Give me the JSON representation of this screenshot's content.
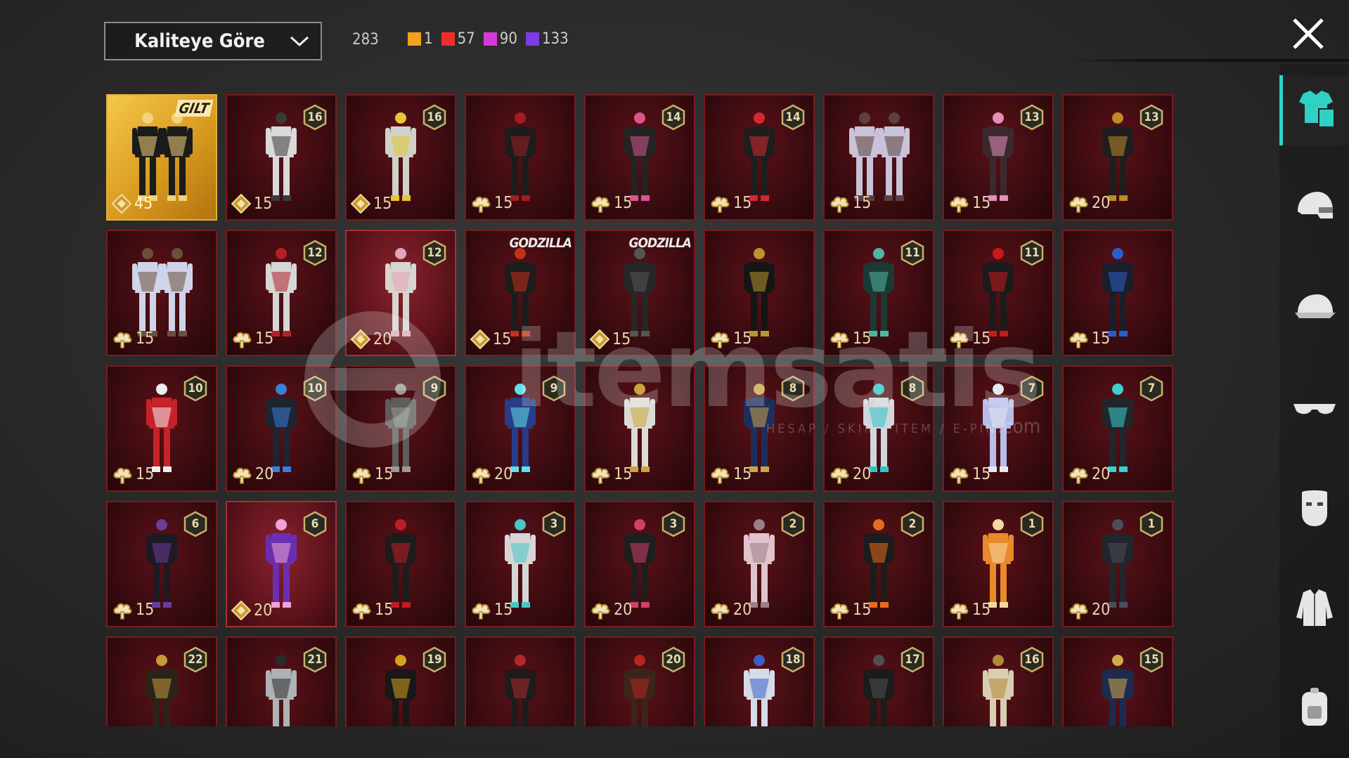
{
  "toolbar": {
    "sort_label": "Kaliteye Göre",
    "total_count": "283",
    "quality_counts": [
      {
        "color": "#f0a31b",
        "count": "1"
      },
      {
        "color": "#f02d2d",
        "count": "57"
      },
      {
        "color": "#d63ad6",
        "count": "90"
      },
      {
        "color": "#7d3ae6",
        "count": "133"
      }
    ]
  },
  "colors": {
    "rarity_red": "#5a1117",
    "rarity_gold": "#e2b23a",
    "active_tab": "#2dd3c7"
  },
  "items": [
    {
      "tag": "GILT",
      "price": "45",
      "currency": "ag",
      "rarity": "gold",
      "figure": "duo-gold"
    },
    {
      "level": "16",
      "price": "15",
      "currency": "ag",
      "figure": "white"
    },
    {
      "level": "16",
      "price": "15",
      "currency": "ag",
      "figure": "white-yellow"
    },
    {
      "price": "15",
      "currency": "uc",
      "figure": "dark-red"
    },
    {
      "level": "14",
      "price": "15",
      "currency": "uc",
      "figure": "dark-pink"
    },
    {
      "level": "14",
      "price": "15",
      "currency": "uc",
      "figure": "red-hood"
    },
    {
      "price": "15",
      "currency": "uc",
      "figure": "duo-white"
    },
    {
      "level": "13",
      "price": "15",
      "currency": "uc",
      "figure": "pink-skirt"
    },
    {
      "level": "13",
      "price": "20",
      "currency": "uc",
      "figure": "gold-dark"
    },
    {
      "price": "15",
      "currency": "uc",
      "figure": "duo-blue"
    },
    {
      "level": "12",
      "price": "15",
      "currency": "uc",
      "figure": "red-white"
    },
    {
      "level": "12",
      "price": "20",
      "currency": "ag",
      "figure": "bunny",
      "highlight": true
    },
    {
      "ribbon": "GODZILLA",
      "price": "15",
      "currency": "ag",
      "figure": "godzilla-red"
    },
    {
      "ribbon": "GODZILLA",
      "price": "15",
      "currency": "ag",
      "figure": "godzilla-dark"
    },
    {
      "price": "15",
      "currency": "uc",
      "figure": "black-gold"
    },
    {
      "level": "11",
      "price": "15",
      "currency": "uc",
      "figure": "teal"
    },
    {
      "level": "11",
      "price": "15",
      "currency": "uc",
      "figure": "red-black"
    },
    {
      "price": "15",
      "currency": "uc",
      "figure": "blue-dark"
    },
    {
      "level": "10",
      "price": "15",
      "currency": "uc",
      "figure": "red-white2"
    },
    {
      "level": "10",
      "price": "20",
      "currency": "uc",
      "figure": "blue-cape"
    },
    {
      "level": "9",
      "price": "15",
      "currency": "uc",
      "figure": "gray"
    },
    {
      "level": "9",
      "price": "20",
      "currency": "uc",
      "figure": "cyan-blue"
    },
    {
      "price": "15",
      "currency": "uc",
      "figure": "white-gold"
    },
    {
      "level": "8",
      "price": "15",
      "currency": "uc",
      "figure": "blue-gold"
    },
    {
      "level": "8",
      "price": "20",
      "currency": "uc",
      "figure": "white-cyan"
    },
    {
      "level": "7",
      "price": "15",
      "currency": "uc",
      "figure": "lavender"
    },
    {
      "level": "7",
      "price": "20",
      "currency": "uc",
      "figure": "dark-cyan"
    },
    {
      "level": "6",
      "price": "15",
      "currency": "uc",
      "figure": "dark-purple"
    },
    {
      "level": "6",
      "price": "20",
      "currency": "ag",
      "figure": "pink-purple",
      "highlight": true
    },
    {
      "price": "15",
      "currency": "uc",
      "figure": "red-hood2"
    },
    {
      "level": "3",
      "price": "15",
      "currency": "uc",
      "figure": "white-cyan2"
    },
    {
      "level": "3",
      "price": "20",
      "currency": "uc",
      "figure": "pink-black"
    },
    {
      "level": "2",
      "price": "20",
      "currency": "uc",
      "figure": "pink-dress"
    },
    {
      "level": "2",
      "price": "15",
      "currency": "uc",
      "figure": "orange-duo"
    },
    {
      "level": "1",
      "price": "15",
      "currency": "uc",
      "figure": "orange-plaid"
    },
    {
      "level": "1",
      "price": "20",
      "currency": "uc",
      "figure": "dark-knight"
    },
    {
      "level": "22",
      "figure": "gold-robe"
    },
    {
      "level": "21",
      "figure": "silver"
    },
    {
      "level": "19",
      "figure": "black-yellow"
    },
    {
      "figure": "red-armor"
    },
    {
      "level": "20",
      "figure": "red-brown"
    },
    {
      "level": "18",
      "figure": "blue-white"
    },
    {
      "level": "17",
      "figure": "black-suit"
    },
    {
      "level": "16",
      "figure": "gold-white"
    },
    {
      "level": "15",
      "figure": "blue-gold2"
    }
  ],
  "sidebar": [
    {
      "icon": "outfit-icon",
      "active": true
    },
    {
      "icon": "helmet-icon"
    },
    {
      "icon": "cap-icon"
    },
    {
      "icon": "glasses-icon"
    },
    {
      "icon": "mask-icon"
    },
    {
      "icon": "jacket-icon"
    },
    {
      "icon": "backpack-icon"
    }
  ],
  "watermark": {
    "brand": "itemsatis",
    "tagline": "HESAP / SKIN / ITEM / E-PIN",
    "suffix": ".com"
  }
}
